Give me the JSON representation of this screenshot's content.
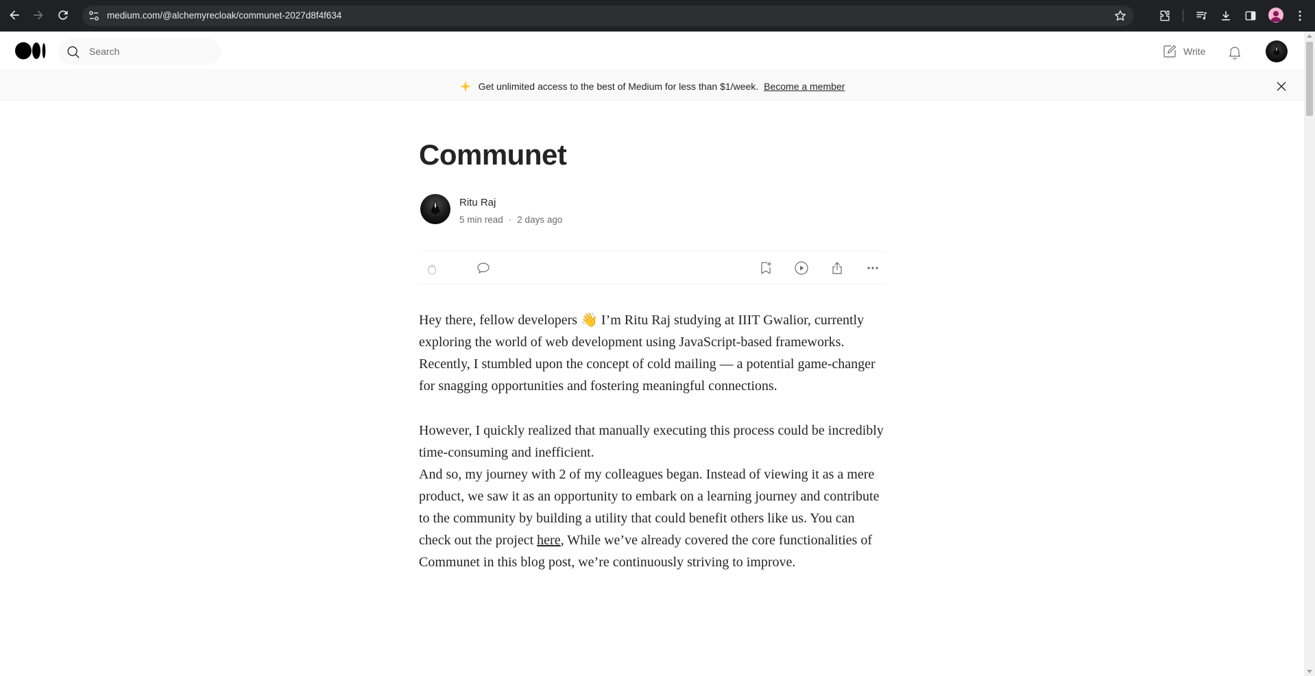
{
  "browser": {
    "url": "medium.com/@alchemyrecloak/communet-2027d8f4f634"
  },
  "header": {
    "search_placeholder": "Search",
    "write_label": "Write"
  },
  "banner": {
    "text": "Get unlimited access to the best of Medium for less than $1/week.",
    "link": "Become a member"
  },
  "article": {
    "title": "Communet",
    "author": "Ritu Raj",
    "read_time": "5 min read",
    "separator": "·",
    "published": "2 days ago",
    "paragraphs": {
      "p1": "Hey there, fellow developers 👋 I’m Ritu Raj studying at IIIT Gwalior, currently exploring the world of web development using JavaScript-based frameworks. Recently, I stumbled upon the concept of cold mailing — a potential game-changer for snagging opportunities and fostering meaningful connections.",
      "p2": "However, I quickly realized that manually executing this process could be incredibly time-consuming and inefficient.",
      "p3_before": "And so, my journey with 2 of my colleagues began. Instead of viewing it as a mere product, we saw it as an opportunity to embark on a learning journey and contribute to the community by building a utility that could benefit others like us. You can check out the project ",
      "p3_link": "here",
      "p3_after": ", While we’ve already covered the core functionalities of Communet in this blog post, we’re continuously striving to improve."
    }
  },
  "colors": {
    "text": "#242424",
    "muted": "#6b6b6b",
    "banner_bg": "#f9f9f9",
    "chrome_bg": "#202124",
    "spark": "#ffc017"
  }
}
